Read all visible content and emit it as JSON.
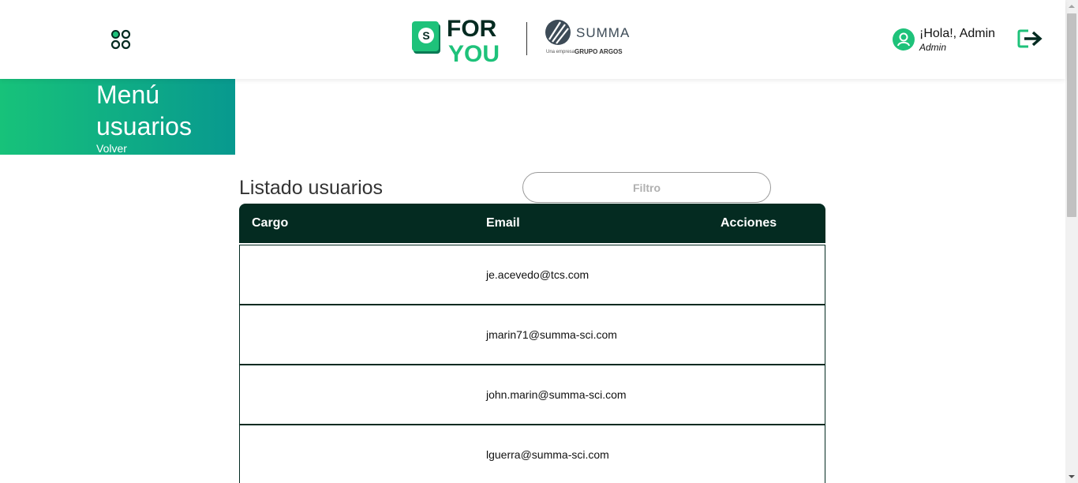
{
  "header": {
    "greeting": "¡Hola!, Admin",
    "role": "Admin",
    "logo_foryou_line1": "FOR",
    "logo_foryou_line2": "YOU",
    "logo_summa": "SUMMA",
    "logo_summa_sub": "Una empresa",
    "logo_summa_group": "GRUPO ARGOS"
  },
  "banner": {
    "title": "Menú usuarios",
    "back_label": "Volver"
  },
  "main": {
    "title": "Listado usuarios",
    "filter_placeholder": "Filtro"
  },
  "table": {
    "columns": [
      "Cargo",
      "Email",
      "Acciones"
    ],
    "rows": [
      {
        "cargo": "",
        "email": "je.acevedo@tcs.com",
        "acciones": ""
      },
      {
        "cargo": "",
        "email": "jmarin71@summa-sci.com",
        "acciones": ""
      },
      {
        "cargo": "",
        "email": "john.marin@summa-sci.com",
        "acciones": ""
      },
      {
        "cargo": "",
        "email": "lguerra@summa-sci.com",
        "acciones": ""
      }
    ]
  },
  "colors": {
    "brand_green": "#1ec27a",
    "dark_green": "#042b21",
    "teal": "#08998f"
  },
  "icons": {
    "apps": "apps-grid-icon",
    "user": "user-icon",
    "logout": "logout-icon"
  }
}
